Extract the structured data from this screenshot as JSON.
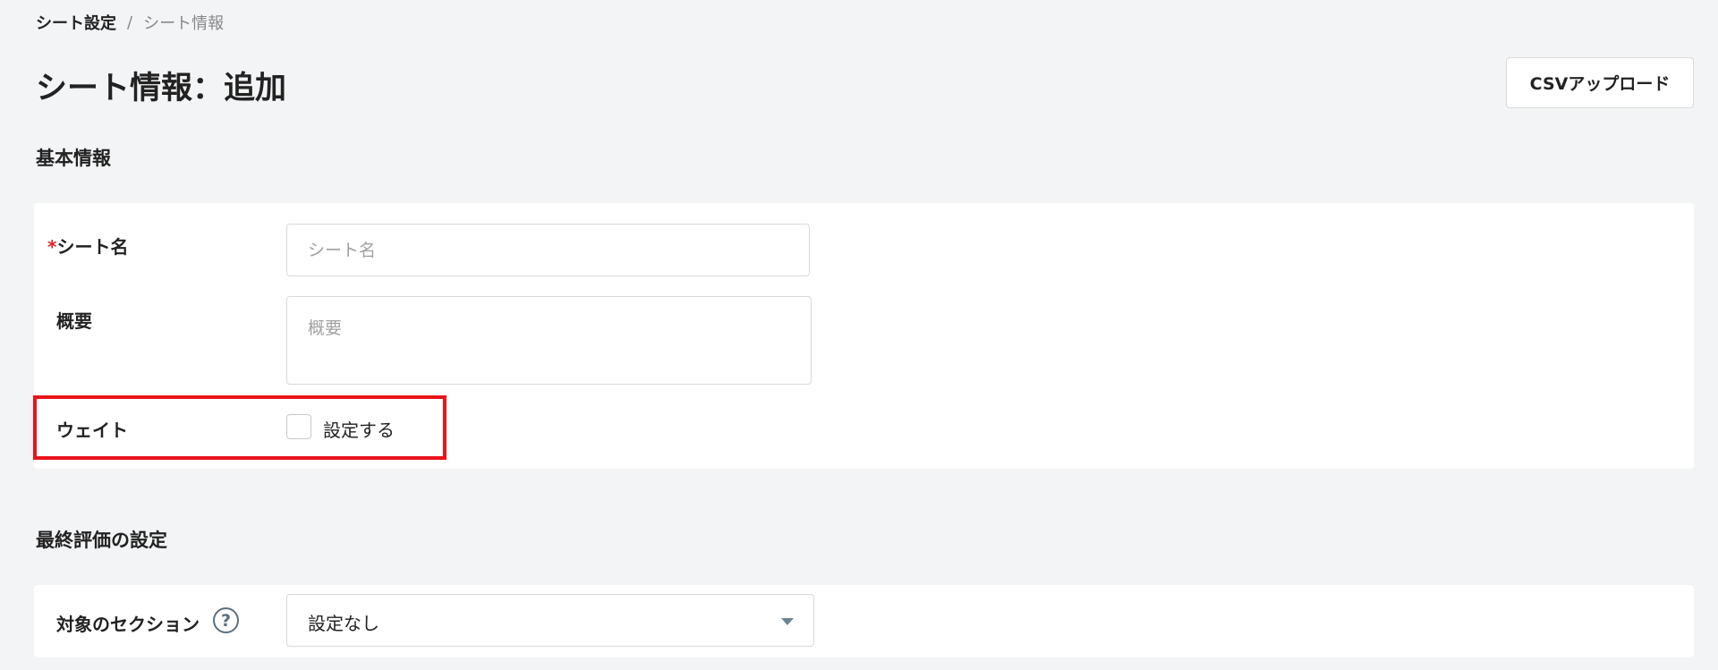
{
  "breadcrumb": {
    "parent": "シート設定",
    "separator": "/",
    "current": "シート情報"
  },
  "page_title": "シート情報：追加",
  "toolbar": {
    "csv_upload_label": "CSVアップロード"
  },
  "basic_section": {
    "heading": "基本情報",
    "sheet_name": {
      "required_mark": "*",
      "label": "シート名",
      "placeholder": "シート名",
      "value": ""
    },
    "summary": {
      "label": "概要",
      "placeholder": "概要",
      "value": ""
    },
    "weight": {
      "label": "ウェイト",
      "checkbox_label": "設定する",
      "checked": false
    }
  },
  "final_eval_section": {
    "heading": "最終評価の設定",
    "target_section": {
      "label": "対象のセクション",
      "help_glyph": "?",
      "selected": "設定なし"
    }
  },
  "colors": {
    "highlight": "#e8141a",
    "required": "#e02020",
    "background": "#f3f4f6"
  },
  "icons": {
    "help": "help-circle-icon",
    "dropdown": "chevron-down-icon"
  }
}
